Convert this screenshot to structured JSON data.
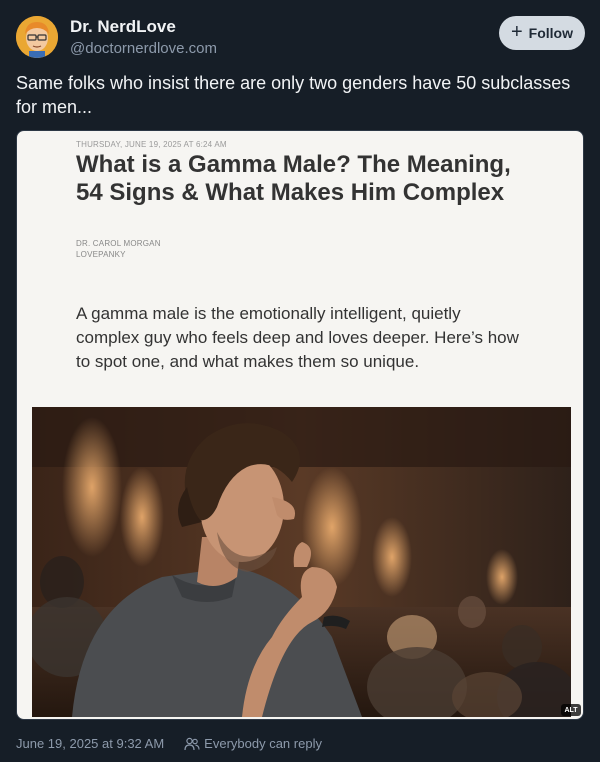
{
  "author": {
    "display_name": "Dr. NerdLove",
    "handle": "@doctornerdlove.com",
    "avatar_icon": "cartoon-avatar"
  },
  "follow_button": {
    "label": "Follow"
  },
  "post": {
    "text": "Same folks who insist there are only two genders have 50 subclasses for men...",
    "timestamp": "June 19, 2025 at 9:32 AM",
    "reply_setting": "Everybody can reply"
  },
  "embed": {
    "date": "THURSDAY, JUNE 19, 2025 AT 6:24 AM",
    "title": "What is a Gamma Male? The Meaning, 54 Signs & What Makes Him Complex",
    "author": "DR. CAROL MORGAN",
    "site": "LOVEPANKY",
    "summary": "A gamma male is the emotionally intelligent, quietly complex guy who feels deep and loves deeper. Here’s how to spot one, and what makes them so unique.",
    "alt_badge": "ALT"
  },
  "colors": {
    "background": "#161e27",
    "card": "#f6f5f2",
    "follow_button_bg": "#d4dbe2",
    "muted_text": "#8d9aab"
  }
}
